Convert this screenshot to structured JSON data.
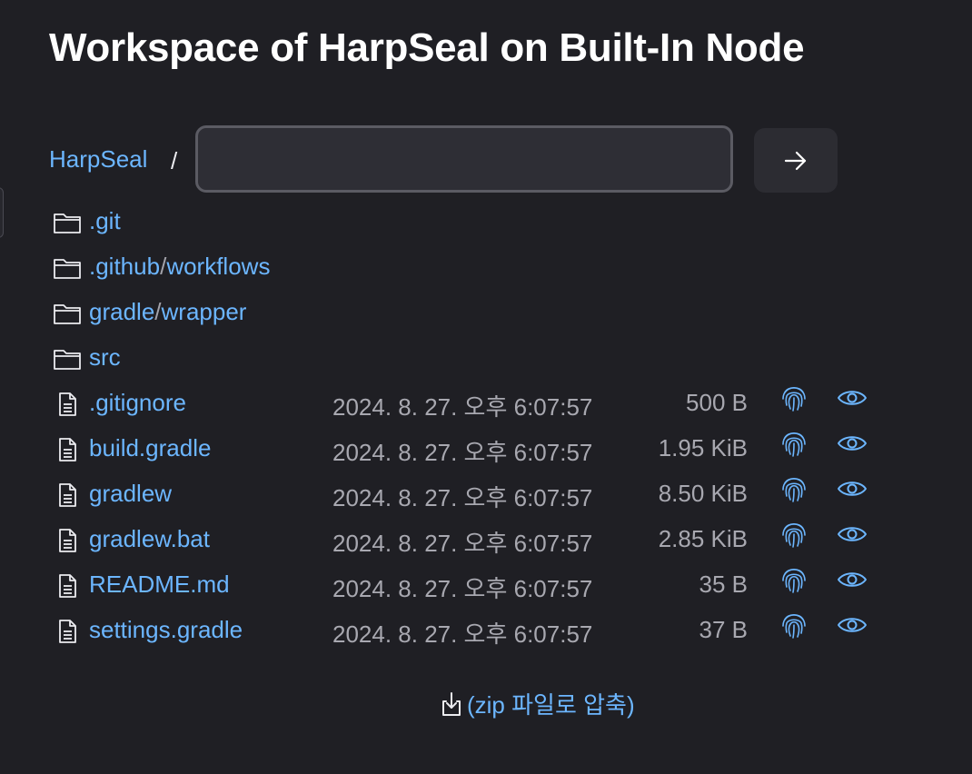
{
  "page": {
    "title": "Workspace of HarpSeal on Built-In Node"
  },
  "pathbar": {
    "crumb": "HarpSeal",
    "separator": "/",
    "input_value": "",
    "go_icon": "arrow-right-icon"
  },
  "directories": [
    {
      "parts": [
        ".git"
      ]
    },
    {
      "parts": [
        ".github",
        "workflows"
      ]
    },
    {
      "parts": [
        "gradle",
        "wrapper"
      ]
    },
    {
      "parts": [
        "src"
      ]
    }
  ],
  "files": [
    {
      "name": ".gitignore",
      "date": "2024. 8. 27. 오후 6:07:57",
      "size": "500 B"
    },
    {
      "name": "build.gradle",
      "date": "2024. 8. 27. 오후 6:07:57",
      "size": "1.95 KiB"
    },
    {
      "name": "gradlew",
      "date": "2024. 8. 27. 오후 6:07:57",
      "size": "8.50 KiB"
    },
    {
      "name": "gradlew.bat",
      "date": "2024. 8. 27. 오후 6:07:57",
      "size": "2.85 KiB"
    },
    {
      "name": "README.md",
      "date": "2024. 8. 27. 오후 6:07:57",
      "size": "35 B"
    },
    {
      "name": "settings.gradle",
      "date": "2024. 8. 27. 오후 6:07:57",
      "size": "37 B"
    }
  ],
  "zip": {
    "label": "(zip 파일로 압축)",
    "icon": "download-icon"
  },
  "colors": {
    "background": "#1f1f24",
    "link": "#6cb6ff",
    "muted": "#a8a8b0"
  }
}
